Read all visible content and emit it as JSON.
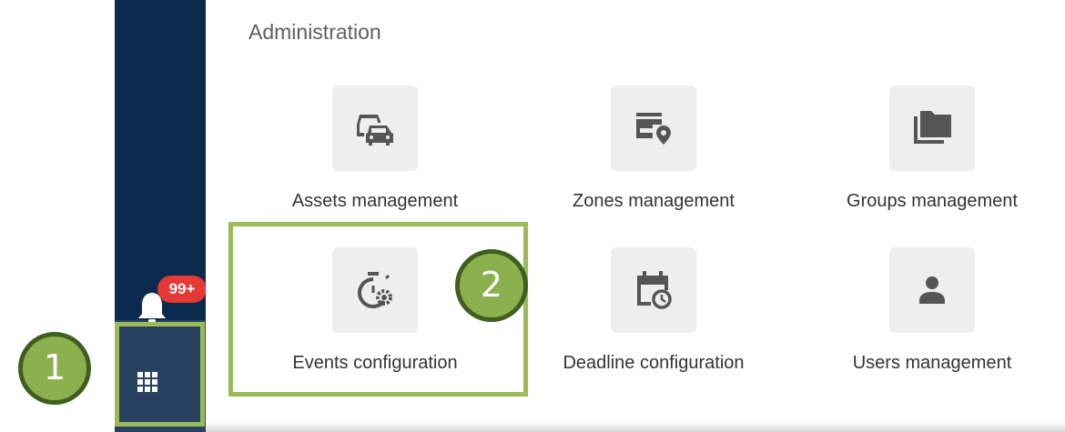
{
  "sidebar": {
    "notification_badge": "99+"
  },
  "panel": {
    "title": "Administration",
    "tiles": [
      {
        "label": "Assets management",
        "icon": "car-fleet-icon"
      },
      {
        "label": "Zones management",
        "icon": "zone-pin-icon"
      },
      {
        "label": "Groups management",
        "icon": "folders-icon"
      },
      {
        "label": "Events configuration",
        "icon": "timer-settings-icon"
      },
      {
        "label": "Deadline configuration",
        "icon": "calendar-clock-icon"
      },
      {
        "label": "Users management",
        "icon": "person-icon"
      }
    ]
  },
  "callouts": [
    "1",
    "2"
  ],
  "colors": {
    "sidebar": "#0b2b4e",
    "sidebar_bottom": "#27415f",
    "badge": "#e53935",
    "highlight": "#9bbb59",
    "callout_fill": "#8db04f",
    "callout_border": "#3f5f1f",
    "tile_bg": "#eeeeee",
    "icon": "#555555"
  }
}
